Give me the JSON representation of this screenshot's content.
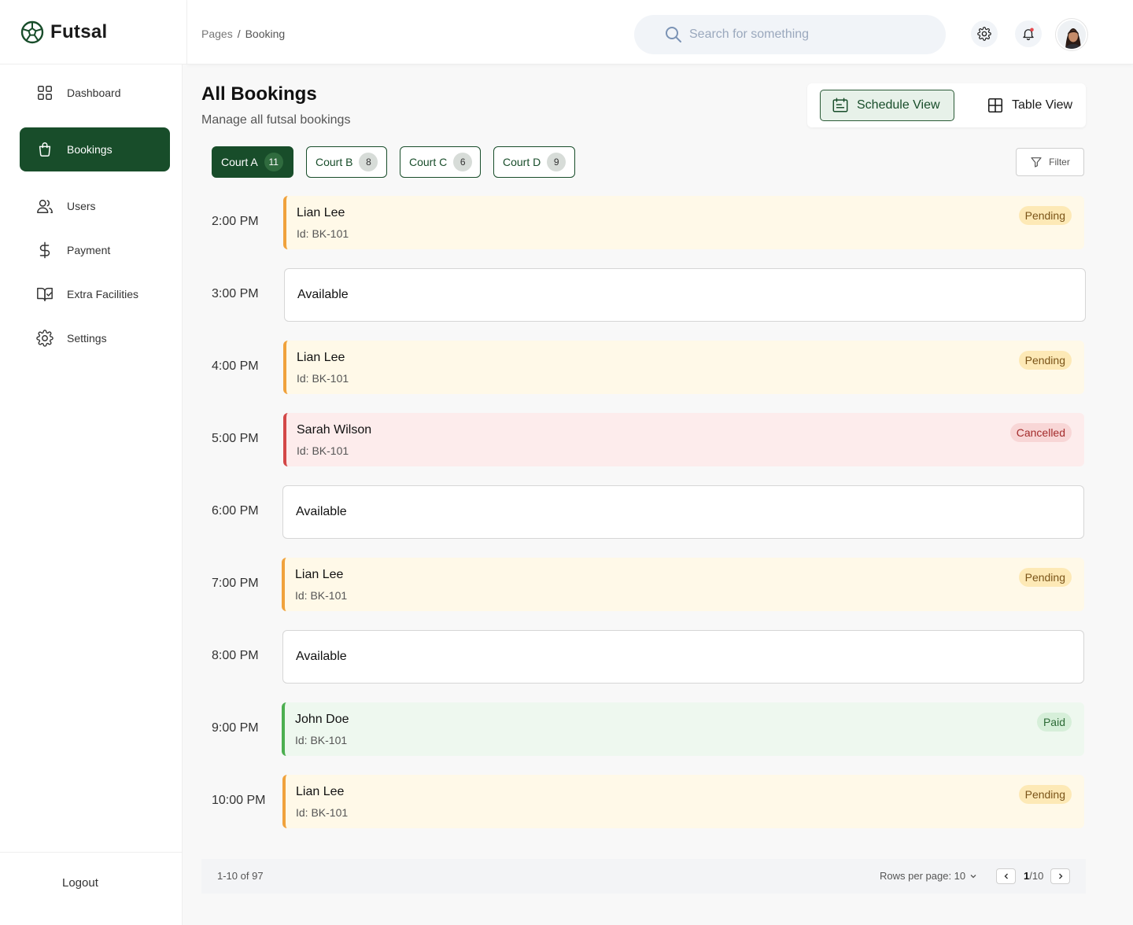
{
  "app": {
    "brand": "Futsal"
  },
  "header": {
    "breadcrumb": [
      "Pages",
      "Booking"
    ],
    "search_placeholder": "Search for something"
  },
  "sidebar": {
    "items": [
      {
        "label": "Dashboard",
        "icon": "grid-icon",
        "active": false
      },
      {
        "label": "Bookings",
        "icon": "bag-icon",
        "active": true
      },
      {
        "label": "Users",
        "icon": "users-icon",
        "active": false
      },
      {
        "label": "Payment",
        "icon": "dollar-icon",
        "active": false
      },
      {
        "label": "Extra Facilities",
        "icon": "book-check-icon",
        "active": false
      },
      {
        "label": "Settings",
        "icon": "gear-icon",
        "active": false
      }
    ],
    "logout": "Logout"
  },
  "main": {
    "title": "All Bookings",
    "subtitle": "Manage all futsal bookings",
    "views": {
      "schedule": "Schedule View",
      "table": "Table View",
      "selected": "schedule"
    },
    "courts": [
      {
        "label": "Court A",
        "count": "11",
        "active": true
      },
      {
        "label": "Court B",
        "count": "8",
        "active": false
      },
      {
        "label": "Court C",
        "count": "6",
        "active": false
      },
      {
        "label": "Court D",
        "count": "9",
        "active": false
      }
    ],
    "filter_label": "Filter",
    "slots": [
      {
        "time": "2:00 PM",
        "type": "pending",
        "name": "Lian Lee",
        "id": "Id: BK-101",
        "status": "Pending"
      },
      {
        "time": "3:00 PM",
        "type": "available",
        "name": "Available"
      },
      {
        "time": "4:00 PM",
        "type": "pending",
        "name": "Lian Lee",
        "id": "Id: BK-101",
        "status": "Pending"
      },
      {
        "time": "5:00 PM",
        "type": "cancelled",
        "name": "Sarah Wilson",
        "id": "Id: BK-101",
        "status": "Cancelled"
      },
      {
        "time": "6:00 PM",
        "type": "available",
        "name": "Available"
      },
      {
        "time": "7:00 PM",
        "type": "pending",
        "name": "Lian Lee",
        "id": "Id: BK-101",
        "status": "Pending"
      },
      {
        "time": "8:00 PM",
        "type": "available",
        "name": "Available"
      },
      {
        "time": "9:00 PM",
        "type": "paid",
        "name": "John Doe",
        "id": "Id: BK-101",
        "status": "Paid"
      },
      {
        "time": "10:00 PM",
        "type": "pending",
        "name": "Lian Lee",
        "id": "Id: BK-101",
        "status": "Pending"
      }
    ],
    "pagination": {
      "range": "1-10 of 97",
      "rows_per_page": "Rows per page: 10",
      "current_page": "1",
      "total_pages": "/10"
    }
  },
  "colors": {
    "brand_green": "#184d2a",
    "pending": "#f0a23c",
    "cancelled": "#d34848",
    "paid": "#4caf50"
  }
}
